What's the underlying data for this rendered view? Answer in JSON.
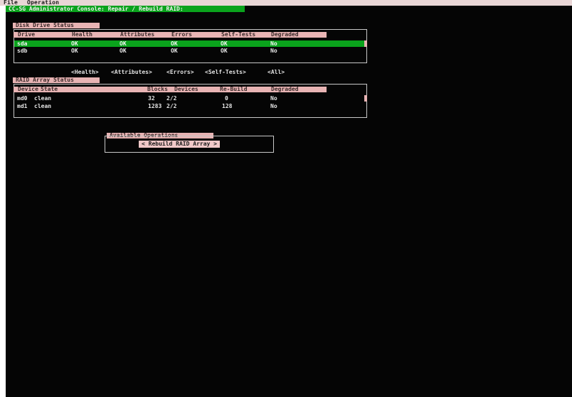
{
  "menu": {
    "file": "File",
    "operation": "Operation"
  },
  "window": {
    "title": "CC-SG Administrator Console: Repair / Rebuild RAID:"
  },
  "disk_panel": {
    "title": "Disk Drive Status",
    "columns": [
      "Drive",
      "Health",
      "Attributes",
      "Errors",
      "Self-Tests",
      "Degraded"
    ],
    "rows": [
      {
        "drive": "sda",
        "health": "OK",
        "attributes": "OK",
        "errors": "OK",
        "self_tests": "OK",
        "degraded": "No"
      },
      {
        "drive": "sdb",
        "health": "OK",
        "attributes": "OK",
        "errors": "OK",
        "self_tests": "OK",
        "degraded": "No"
      }
    ]
  },
  "detail_tabs": [
    "<Health>",
    "<Attributes>",
    "<Errors>",
    "<Self-Tests>",
    "<All>"
  ],
  "raid_panel": {
    "title": "RAID Array Status",
    "columns": [
      "Device",
      "State",
      "Blocks",
      "Devices",
      "Re-Build",
      "Degraded"
    ],
    "rows": [
      {
        "device": "md0",
        "state": "clean",
        "blocks": "32",
        "devices": "2/2",
        "rebuild": "0",
        "degraded": "No"
      },
      {
        "device": "md1",
        "state": "clean",
        "blocks": "1283",
        "devices": "2/2",
        "rebuild": "128",
        "degraded": "No"
      }
    ]
  },
  "ops_panel": {
    "title": "Available Operations",
    "button": "< Rebuild RAID Array >"
  }
}
